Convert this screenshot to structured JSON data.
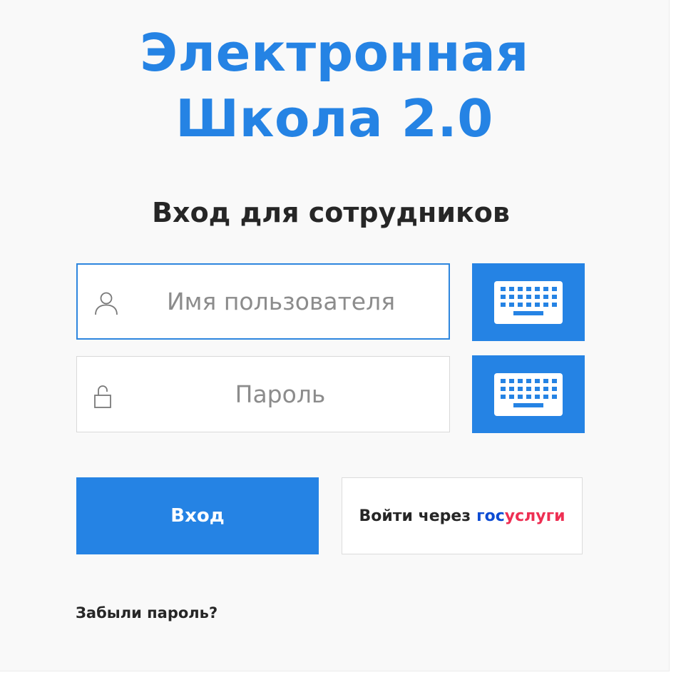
{
  "app": {
    "title_line1": "Электронная",
    "title_line2": "Школа 2.0"
  },
  "login": {
    "heading": "Вход для сотрудников",
    "username": {
      "value": "",
      "placeholder": "Имя пользователя",
      "icon": "user-icon"
    },
    "password": {
      "value": "",
      "placeholder": "Пароль",
      "icon": "unlock-icon"
    },
    "keyboard_buttons": [
      {
        "icon": "keyboard-icon"
      },
      {
        "icon": "keyboard-icon"
      }
    ],
    "submit_label": "Вход",
    "gosuslugi": {
      "prefix": "Войти через",
      "brand_part1": "гос",
      "brand_part2": "услуги"
    },
    "forgot_label": "Забыли пароль?"
  },
  "colors": {
    "accent": "#2583e4",
    "field_focus_border": "#2e86de",
    "gosuslugi_blue": "#0d4cd3",
    "gosuslugi_red": "#ee2f53",
    "text": "#262626"
  }
}
